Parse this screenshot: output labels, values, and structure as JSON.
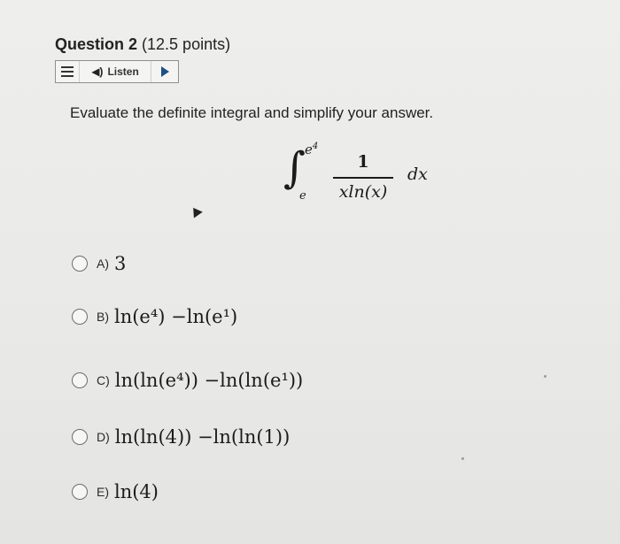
{
  "question": {
    "label": "Question 2",
    "points": "(12.5 points)"
  },
  "listen_bar": {
    "menu_icon": "menu-icon",
    "speaker_icon": "speaker-icon",
    "listen_label": "Listen",
    "play_icon": "play-icon",
    "accent": "#1f4f86"
  },
  "prompt": "Evaluate the definite integral and simplify your answer.",
  "integral": {
    "upper_base": "e",
    "upper_exp": "4",
    "lower": "e",
    "numerator": "1",
    "denominator": "xln(x)",
    "differential": "dx"
  },
  "options": [
    {
      "letter": "A)",
      "text": "3"
    },
    {
      "letter": "B)",
      "text": "ln(e⁴) −ln(e¹)"
    },
    {
      "letter": "C)",
      "text": "ln(ln(e⁴)) −ln(ln(e¹))"
    },
    {
      "letter": "D)",
      "text": "ln(ln(4)) −ln(ln(1))"
    },
    {
      "letter": "E)",
      "text": "ln(4)"
    }
  ]
}
